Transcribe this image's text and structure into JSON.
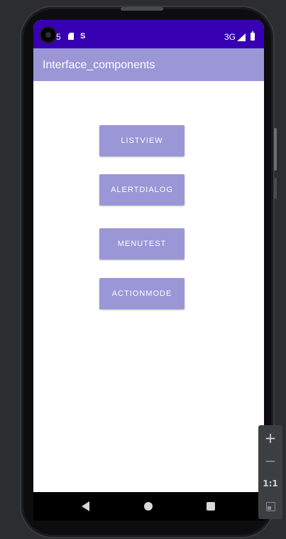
{
  "status_bar": {
    "time": "5",
    "network": "3G",
    "icons": [
      "sd-card-icon",
      "s-icon",
      "signal-icon",
      "battery-icon"
    ]
  },
  "app_bar": {
    "title": "Interface_components"
  },
  "buttons": [
    {
      "label": "LISTVIEW"
    },
    {
      "label": "ALERTDIALOG"
    },
    {
      "label": "MENUTEST"
    },
    {
      "label": "ACTIONMODE"
    }
  ],
  "nav_bar": {
    "icons": [
      "back-icon",
      "home-icon",
      "recents-icon"
    ]
  },
  "zoom_toolbar": {
    "zoom_in": "+",
    "zoom_out": "−",
    "actual_size": "1:1"
  },
  "colors": {
    "status_bar": "#3700b3",
    "app_bar": "#9b96d6",
    "button": "#9b96d6",
    "button_text": "#ffffff"
  }
}
